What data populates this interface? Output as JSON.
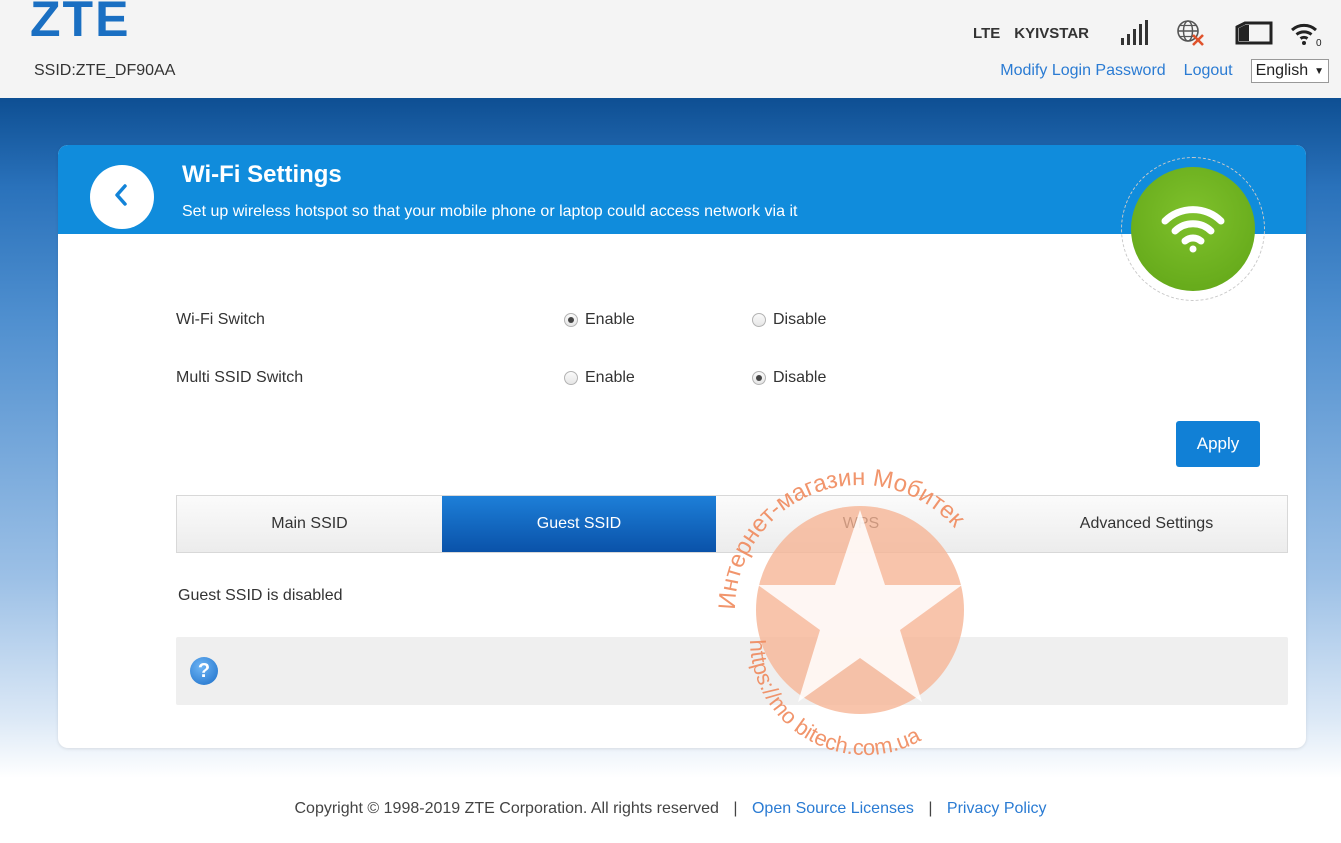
{
  "header": {
    "logo": "ZTE",
    "ssid": "SSID:ZTE_DF90AA",
    "network_type": "LTE",
    "operator": "KYIVSTAR",
    "links": {
      "modify_password": "Modify Login Password",
      "logout": "Logout"
    },
    "language": "English"
  },
  "card": {
    "title": "Wi-Fi Settings",
    "subtitle": "Set up wireless hotspot so that your mobile phone or laptop could access network via it"
  },
  "settings": {
    "wifi_switch": {
      "label": "Wi-Fi Switch",
      "enable": "Enable",
      "disable": "Disable",
      "selected": "Enable"
    },
    "multi_ssid_switch": {
      "label": "Multi SSID Switch",
      "enable": "Enable",
      "disable": "Disable",
      "selected": "Disable"
    },
    "apply_label": "Apply"
  },
  "tabs": [
    {
      "label": "Main SSID",
      "active": false
    },
    {
      "label": "Guest SSID",
      "active": true
    },
    {
      "label": "WPS",
      "active": false
    },
    {
      "label": "Advanced Settings",
      "active": false
    }
  ],
  "status_message": "Guest SSID is disabled",
  "help_icon_label": "?",
  "watermark": {
    "shop": "Интернет-магазин Мобитек",
    "url": "https://mo bitech.com.ua"
  },
  "footer": {
    "copyright": "Copyright © 1998-2019 ZTE Corporation. All rights reserved",
    "sep1": "|",
    "open_source": "Open Source Licenses",
    "sep2": "|",
    "privacy": "Privacy Policy"
  },
  "colors": {
    "header_blue": "#108cdc",
    "active_tab": "#0a52a9",
    "link": "#2a7bd3",
    "wifi_green": "#6cb11e",
    "watermark": "#f4a07c"
  },
  "icons": [
    "signal-bars-icon",
    "globe-disconnected-icon",
    "battery-icon",
    "wifi-status-icon",
    "back-chevron-icon",
    "wifi-icon",
    "help-icon"
  ]
}
